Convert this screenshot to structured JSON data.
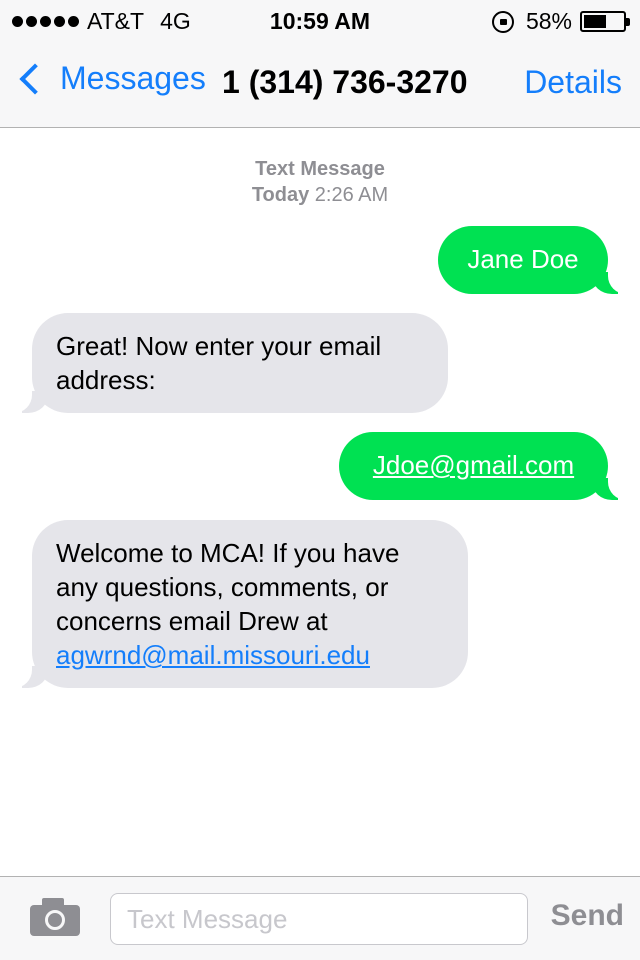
{
  "status_bar": {
    "signal_bars": 5,
    "carrier": "AT&T",
    "network": "4G",
    "time": "10:59 AM",
    "battery_percent_label": "58%",
    "battery_level": 0.58,
    "icons": [
      "signal-dots-icon",
      "orientation-lock-icon",
      "battery-icon"
    ]
  },
  "nav": {
    "back_label": "Messages",
    "title": "1 (314) 736-3270",
    "details_label": "Details"
  },
  "conversation": {
    "header_type": "Text Message",
    "header_day": "Today",
    "header_time": "2:26 AM",
    "messages": [
      {
        "direction": "outgoing",
        "text": "Jane Doe"
      },
      {
        "direction": "incoming",
        "text": "Great! Now enter your email address:"
      },
      {
        "direction": "outgoing",
        "text": "Jdoe@gmail.com",
        "is_link": true
      },
      {
        "direction": "incoming",
        "text": "Welcome to MCA! If you have any questions, comments, or concerns email Drew at",
        "link": "agwrnd@mail.missouri.edu"
      }
    ]
  },
  "composer": {
    "placeholder": "Text Message",
    "value": "",
    "send_label": "Send",
    "camera_icon": "camera-icon"
  },
  "colors": {
    "accent": "#147efb",
    "outgoing_bubble": "#00e152",
    "incoming_bubble": "#e5e5ea",
    "muted": "#8e8e93"
  }
}
